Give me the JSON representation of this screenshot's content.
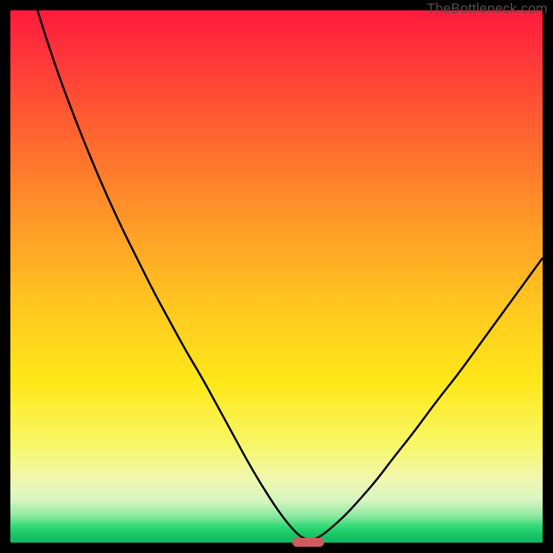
{
  "watermark": "TheBottleneck.com",
  "colors": {
    "curve_stroke": "#000000",
    "marker_fill": "#cf5b60"
  },
  "chart_data": {
    "type": "line",
    "title": "",
    "xlabel": "",
    "ylabel": "",
    "xlim": [
      0,
      100
    ],
    "ylim": [
      0,
      100
    ],
    "x": [
      0,
      3,
      6,
      9,
      12,
      15,
      18,
      21,
      24,
      27,
      30,
      33,
      36,
      39,
      42,
      45,
      48,
      51,
      53.5,
      55,
      56.5,
      58,
      60,
      63,
      66,
      69,
      72,
      76,
      80,
      84,
      88,
      92,
      96,
      100
    ],
    "values": [
      118,
      107,
      97,
      88,
      80,
      72.5,
      65.5,
      59,
      53,
      47,
      41.5,
      36,
      31,
      25.5,
      20,
      14.5,
      9.5,
      5,
      2,
      0.8,
      0.5,
      1,
      2.5,
      5.2,
      8.5,
      12,
      16,
      21,
      26.5,
      31.5,
      37,
      42.5,
      48,
      53.5
    ],
    "marker": {
      "x_center": 56,
      "width_pct": 6
    }
  }
}
